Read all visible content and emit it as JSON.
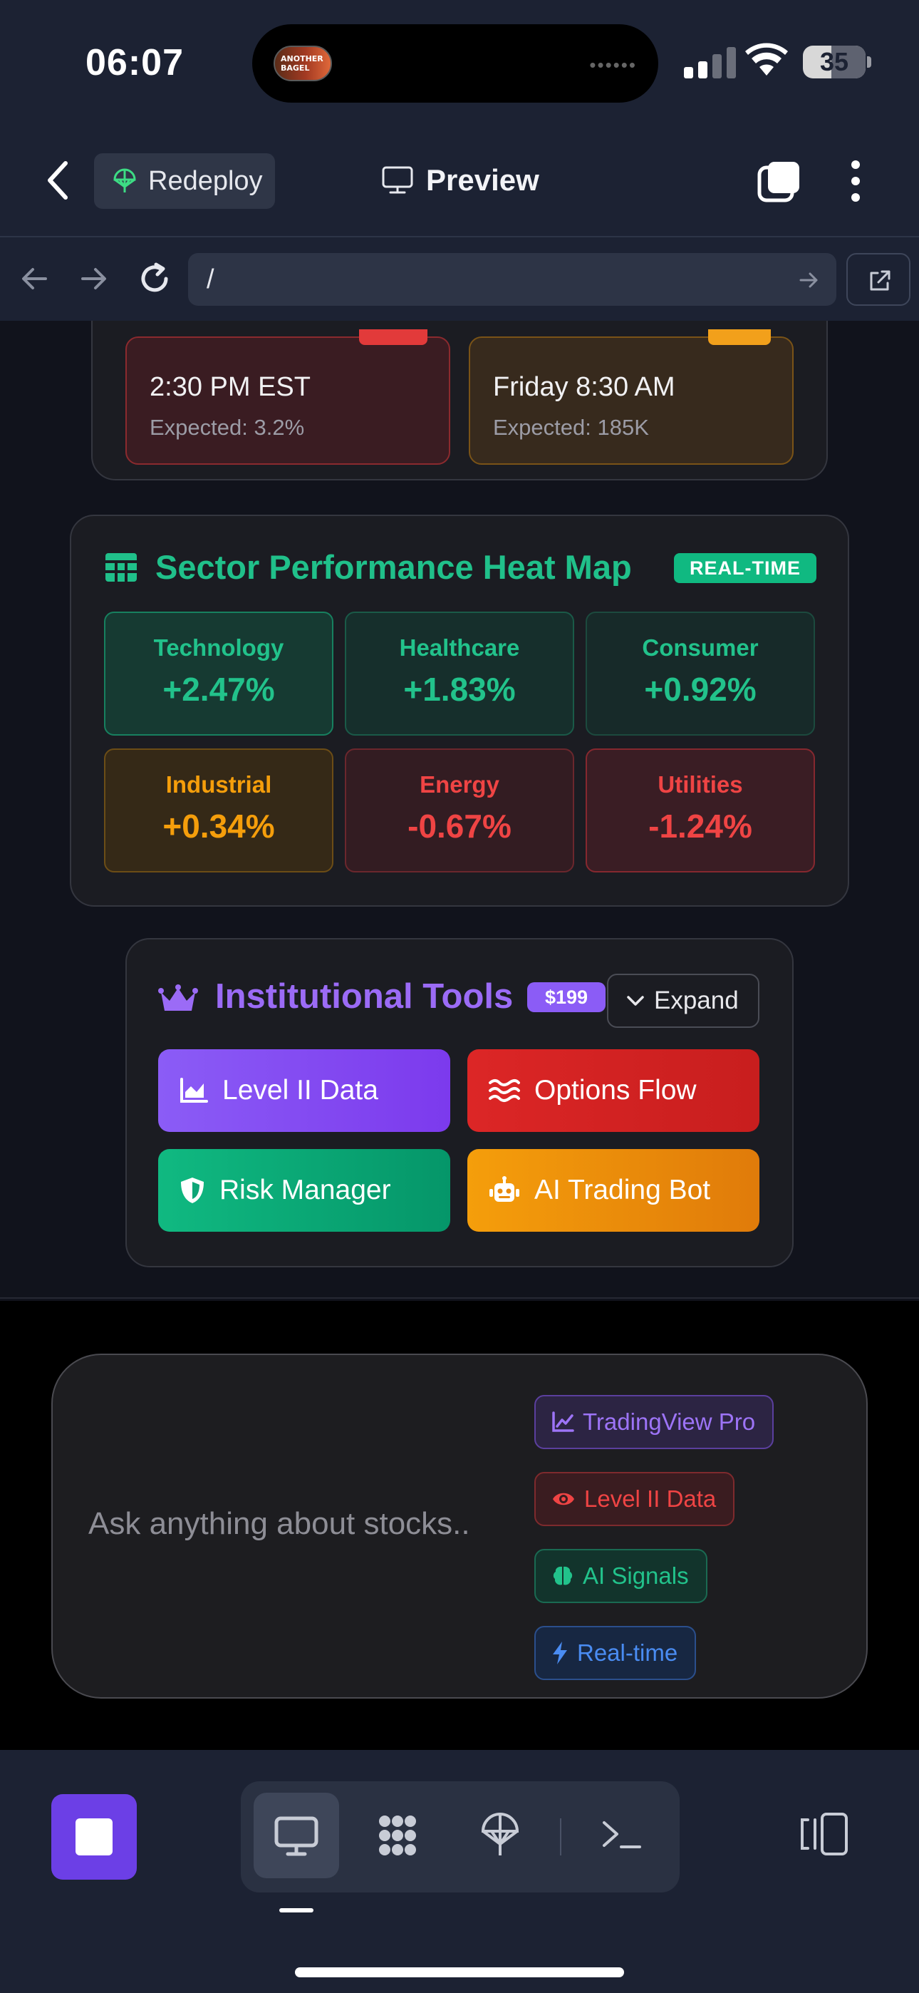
{
  "status_bar": {
    "time": "06:07",
    "island_art_text": "ANOTHER\nBAGEL",
    "island_dots": "••••••",
    "battery": "35"
  },
  "top_bar": {
    "redeploy_label": "Redeploy",
    "preview_label": "Preview"
  },
  "url_bar": {
    "url": "/"
  },
  "econ_events": [
    {
      "time": "2:30 PM EST",
      "expected": "Expected: 3.2%",
      "color": "#e23a3a"
    },
    {
      "time": "Friday 8:30 AM",
      "expected": "Expected: 185K",
      "color": "#f2a01b"
    }
  ],
  "sector_heatmap": {
    "title": "Sector Performance Heat Map",
    "badge": "REAL-TIME",
    "sectors": [
      {
        "name": "Technology",
        "change": "+2.47%"
      },
      {
        "name": "Healthcare",
        "change": "+1.83%"
      },
      {
        "name": "Consumer",
        "change": "+0.92%"
      },
      {
        "name": "Industrial",
        "change": "+0.34%"
      },
      {
        "name": "Energy",
        "change": "-0.67%"
      },
      {
        "name": "Utilities",
        "change": "-1.24%"
      }
    ]
  },
  "institutional_tools": {
    "title": "Institutional Tools",
    "price": "$199",
    "expand_label": "Expand",
    "tools": [
      {
        "label": "Level II Data",
        "icon": "area-chart-icon",
        "color": "#8b5cf6"
      },
      {
        "label": "Options Flow",
        "icon": "waves-icon",
        "color": "#dc2626"
      },
      {
        "label": "Risk Manager",
        "icon": "shield-icon",
        "color": "#10b981"
      },
      {
        "label": "AI Trading Bot",
        "icon": "robot-icon",
        "color": "#f59e0b"
      }
    ]
  },
  "chat": {
    "placeholder": "Ask anything about stocks..",
    "chips": [
      {
        "label": "TradingView Pro",
        "icon": "line-chart-icon"
      },
      {
        "label": "Level II Data",
        "icon": "eye-icon"
      },
      {
        "label": "AI Signals",
        "icon": "brain-icon"
      },
      {
        "label": "Real-time",
        "icon": "lightning-icon"
      }
    ]
  },
  "dock": {
    "tabs": [
      "desktop-icon",
      "apps-icon",
      "deploy-icon",
      "terminal-icon"
    ],
    "active_tab": "desktop-icon"
  },
  "colors": {
    "accent_green": "#20c08a",
    "accent_purple": "#8b5cf6",
    "accent_red": "#ef4444",
    "accent_amber": "#f59e0b",
    "chrome_bg": "#1c2233"
  }
}
